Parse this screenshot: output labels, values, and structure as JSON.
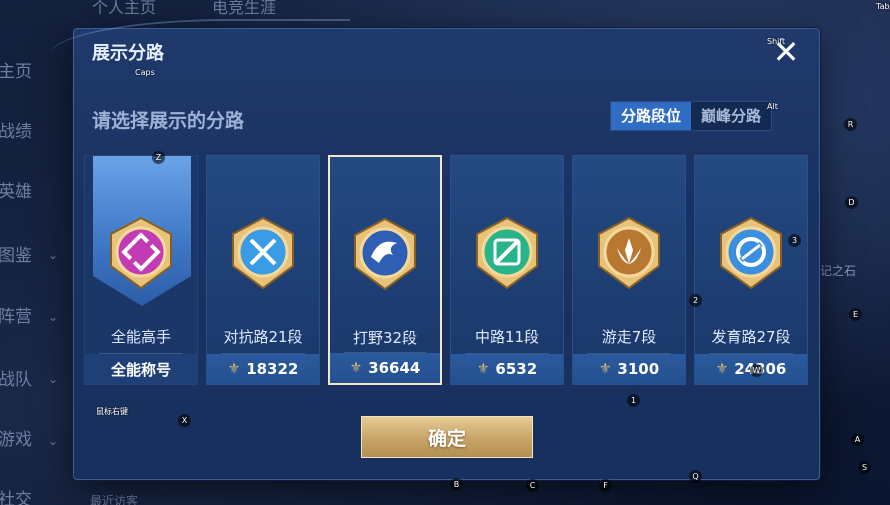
{
  "background": {
    "nav_items": [
      "主页",
      "战绩",
      "英雄",
      "图鉴",
      "阵营",
      "战队",
      "游戏",
      "社交"
    ],
    "top_tabs": [
      "个人主页",
      "电竞生涯"
    ],
    "right_text": "记之石",
    "bottom_text": "最近访客"
  },
  "dialog": {
    "title": "展示分路",
    "close_label": "✕",
    "subtitle": "请选择展示的分路",
    "tabs": [
      {
        "label": "分路段位",
        "active": true
      },
      {
        "label": "巅峰分路",
        "active": false
      }
    ],
    "cards": [
      {
        "label": "全能高手",
        "footer": "全能称号",
        "icon": "all-round-badge-icon",
        "accent": "#c23bb5",
        "has_points": false,
        "banner": true
      },
      {
        "label": "对抗路21段",
        "footer": "18322",
        "icon": "clash-lane-badge-icon",
        "accent": "#3a9be6",
        "has_points": true
      },
      {
        "label": "打野32段",
        "footer": "36644",
        "icon": "jungle-badge-icon",
        "accent": "#2f5fb5",
        "has_points": true,
        "selected": true
      },
      {
        "label": "中路11段",
        "footer": "6532",
        "icon": "mid-lane-badge-icon",
        "accent": "#27b48a",
        "has_points": true
      },
      {
        "label": "游走7段",
        "footer": "3100",
        "icon": "roam-badge-icon",
        "accent": "#b9782f",
        "has_points": true
      },
      {
        "label": "发育路27段",
        "footer": "24306",
        "icon": "farm-lane-badge-icon",
        "accent": "#3a8fe0",
        "has_points": true
      }
    ],
    "confirm_label": "确定"
  },
  "key_hints": [
    {
      "k": "Caps"
    },
    {
      "k": "Shift"
    },
    {
      "k": "Alt"
    },
    {
      "k": "Tab"
    },
    {
      "k": "Z"
    },
    {
      "k": "R"
    },
    {
      "k": "D"
    },
    {
      "k": "3"
    },
    {
      "k": "2"
    },
    {
      "k": "E"
    },
    {
      "k": "W"
    },
    {
      "k": "1"
    },
    {
      "k": "X"
    },
    {
      "k": "B"
    },
    {
      "k": "C"
    },
    {
      "k": "F"
    },
    {
      "k": "Q"
    },
    {
      "k": "A"
    },
    {
      "k": "S"
    },
    {
      "k": "鼠标右键"
    }
  ]
}
